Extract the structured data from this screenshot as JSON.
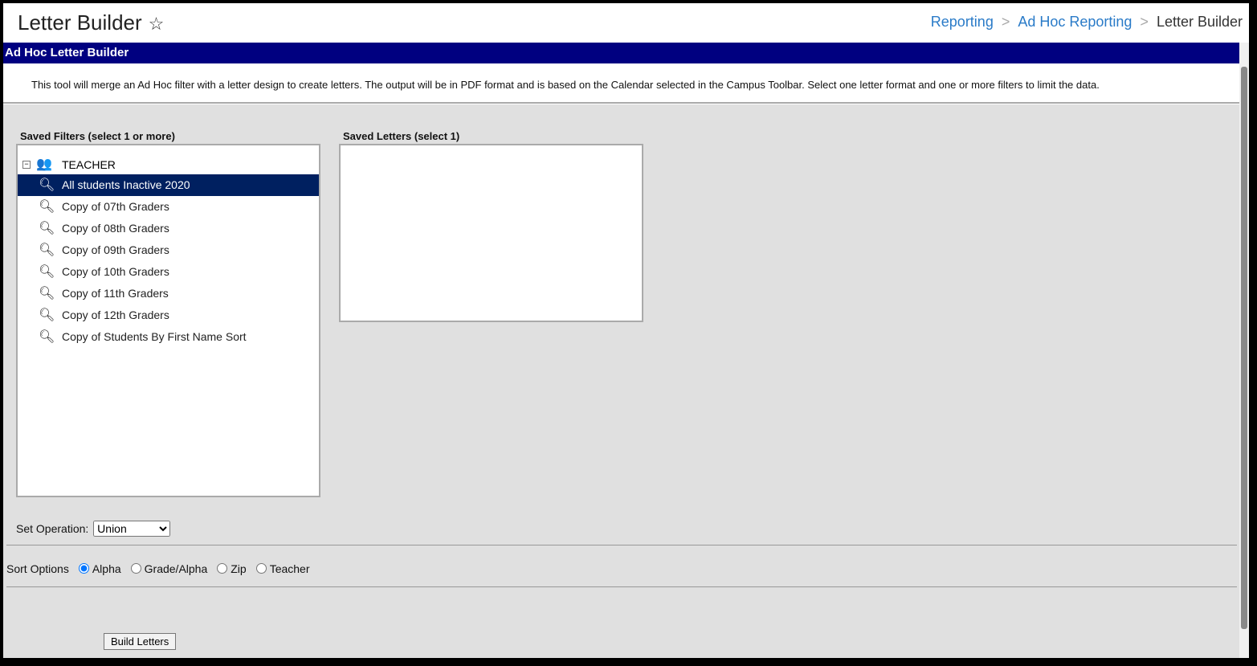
{
  "header": {
    "title": "Letter Builder",
    "breadcrumb": [
      "Reporting",
      "Ad Hoc Reporting",
      "Letter Builder"
    ]
  },
  "section_title": "Ad Hoc Letter Builder",
  "description": "This tool will merge an Ad Hoc filter with a letter design to create letters. The output will be in PDF format and is based on the Calendar selected in the Campus Toolbar. Select one letter format and one or more filters to limit the data.",
  "filters": {
    "label": "Saved Filters (select 1 or more)",
    "group": "TEACHER",
    "items": [
      "All students Inactive 2020",
      "Copy of 07th Graders",
      "Copy of 08th Graders",
      "Copy of 09th Graders",
      "Copy of 10th Graders",
      "Copy of 11th Graders",
      "Copy of 12th Graders",
      "Copy of Students By First Name Sort"
    ],
    "selected": "All students Inactive 2020"
  },
  "letters": {
    "label": "Saved Letters (select 1)"
  },
  "set_operation": {
    "label": "Set Operation:",
    "value": "Union"
  },
  "sort": {
    "label": "Sort Options",
    "options": [
      "Alpha",
      "Grade/Alpha",
      "Zip",
      "Teacher"
    ],
    "selected": "Alpha"
  },
  "build_label": "Build Letters"
}
